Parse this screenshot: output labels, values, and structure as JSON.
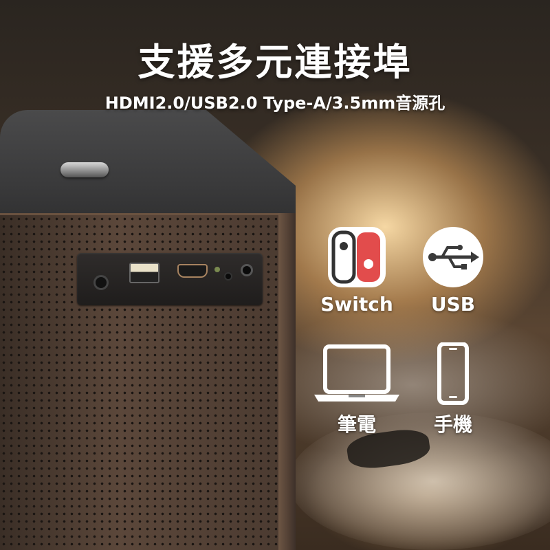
{
  "headline": {
    "title": "支援多元連接埠",
    "subtitle": "HDMI2.0/USB2.0 Type-A/3.5mm音源孔"
  },
  "devices": [
    {
      "label": "Switch",
      "icon": "switch-console-icon"
    },
    {
      "label": "USB",
      "icon": "usb-icon"
    },
    {
      "label": "筆電",
      "icon": "laptop-icon"
    },
    {
      "label": "手機",
      "icon": "smartphone-icon"
    }
  ],
  "colors": {
    "text": "#ffffff",
    "projector_top": "#3a3a3b",
    "projector_body": "#4a3a30",
    "background_warm": "#e6aa64"
  }
}
